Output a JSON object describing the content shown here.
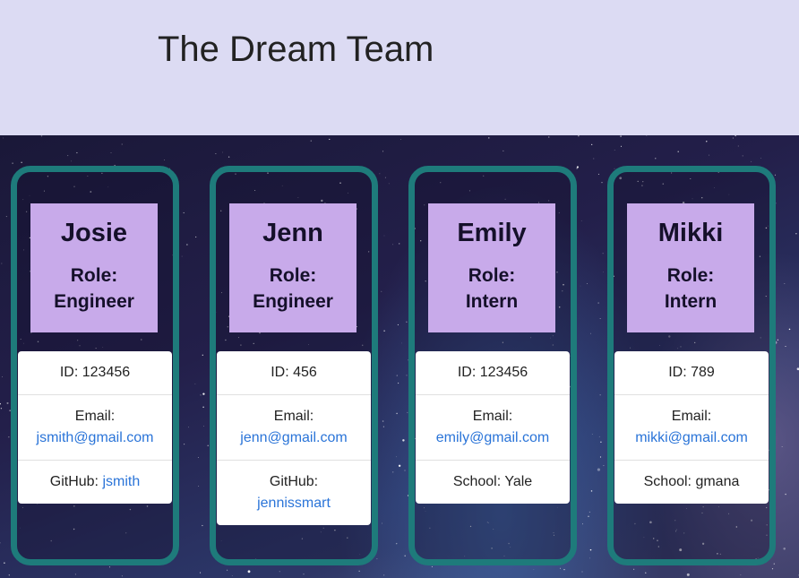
{
  "page": {
    "title": "The Dream Team"
  },
  "colors": {
    "header_bg": "#dcdbf3",
    "card_border": "#1e7b7b",
    "card_head_bg": "#c8aaea",
    "link": "#2a74d8"
  },
  "members": [
    {
      "name": "Josie",
      "role_label": "Role:",
      "role": "Engineer",
      "id_label": "ID:",
      "id": "123456",
      "email_label": "Email:",
      "email": "jsmith@gmail.com",
      "extra_label": "GitHub:",
      "extra": "jsmith",
      "extra_is_link": true
    },
    {
      "name": "Jenn",
      "role_label": "Role:",
      "role": "Engineer",
      "id_label": "ID:",
      "id": "456",
      "email_label": "Email:",
      "email": "jenn@gmail.com",
      "extra_label": "GitHub:",
      "extra": "jennissmart",
      "extra_is_link": true
    },
    {
      "name": "Emily",
      "role_label": "Role:",
      "role": "Intern",
      "id_label": "ID:",
      "id": "123456",
      "email_label": "Email:",
      "email": "emily@gmail.com",
      "extra_label": "School:",
      "extra": "Yale",
      "extra_is_link": false
    },
    {
      "name": "Mikki",
      "role_label": "Role:",
      "role": "Intern",
      "id_label": "ID:",
      "id": "789",
      "email_label": "Email:",
      "email": "mikki@gmail.com",
      "extra_label": "School:",
      "extra": "gmana",
      "extra_is_link": false
    }
  ]
}
